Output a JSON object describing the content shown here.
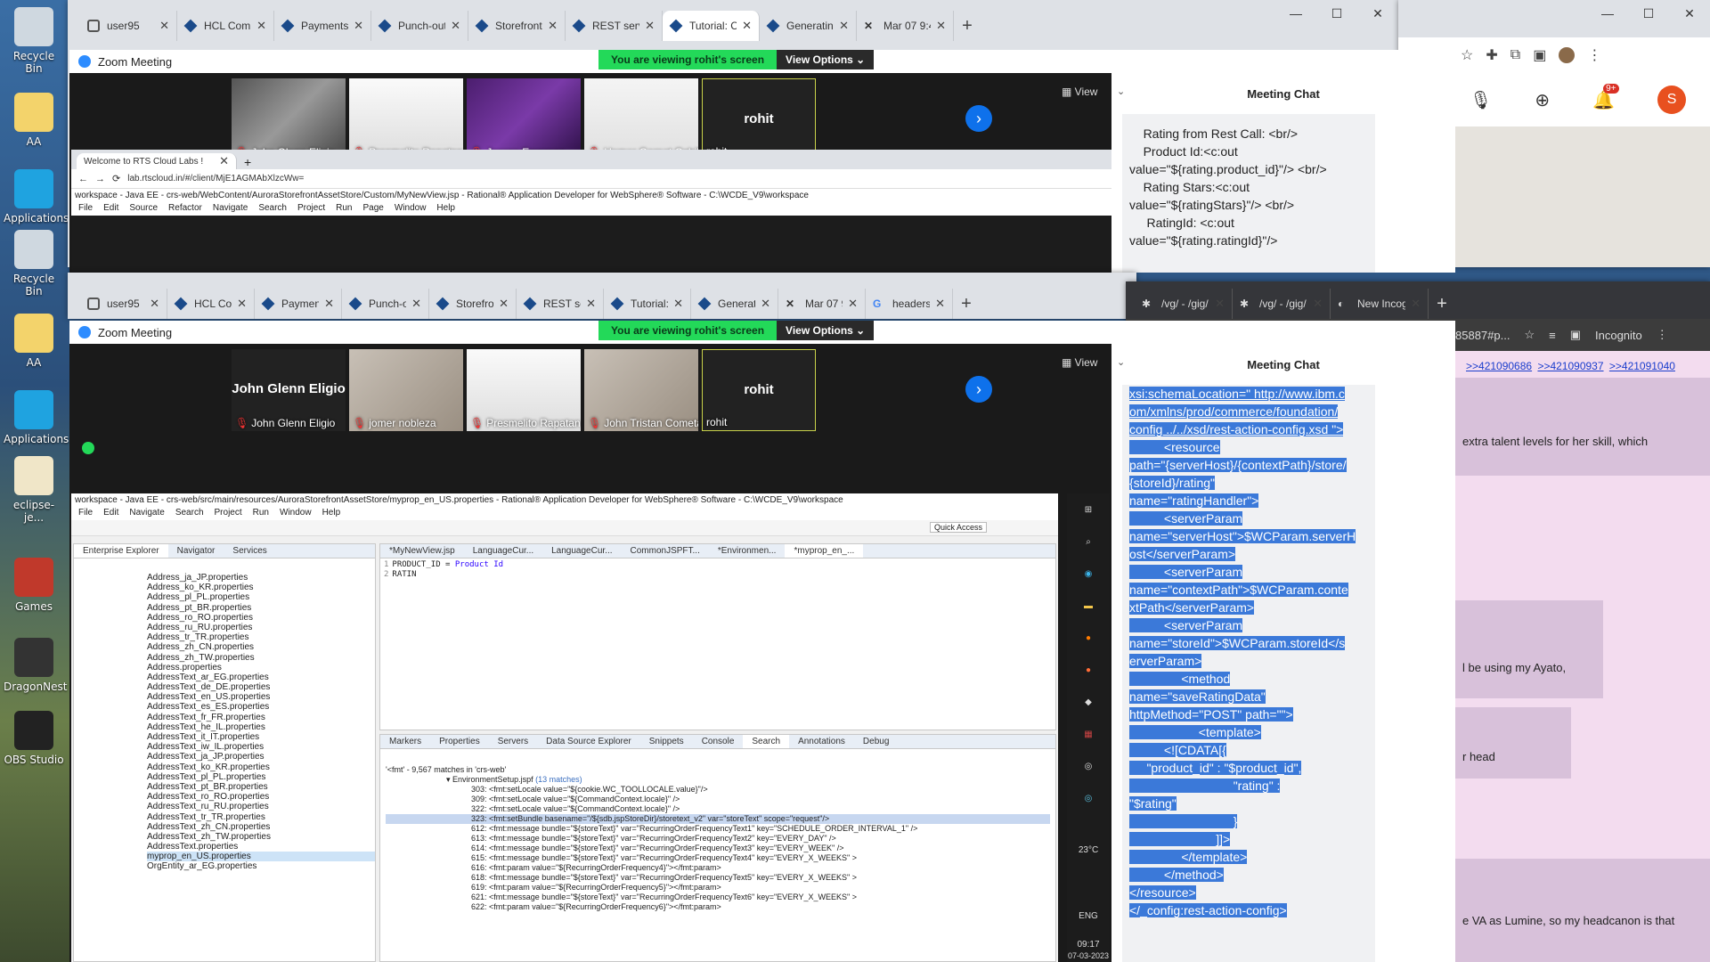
{
  "desktop": {
    "icons": [
      {
        "label": "Recycle Bin",
        "icon": "recycle-bin-icon"
      },
      {
        "label": "AA",
        "icon": "folder-icon"
      },
      {
        "label": "Applications",
        "icon": "edge-icon"
      },
      {
        "label": "Recycle Bin",
        "icon": "recycle-bin-icon"
      },
      {
        "label": "AA",
        "icon": "folder-icon"
      },
      {
        "label": "Applications",
        "icon": "edge-icon"
      },
      {
        "label": "eclipse-je...",
        "icon": "file-icon"
      },
      {
        "label": "Games",
        "icon": "games-icon"
      },
      {
        "label": "DragonNest",
        "icon": "dragonnest-icon"
      },
      {
        "label": "OBS Studio",
        "icon": "obs-icon"
      }
    ]
  },
  "top_browser": {
    "tabs": [
      "user95",
      "HCL Comme",
      "Payments sys",
      "Punch-out p",
      "Storefront RE",
      "REST service",
      "Tutorial: Crea",
      "Generating th",
      "Mar 07 9:49"
    ],
    "active_tab": 6
  },
  "bottom_browser": {
    "tabs": [
      "user95",
      "HCL Comm",
      "Payments",
      "Punch-out",
      "Storefront",
      "REST servi",
      "Tutorial: C",
      "Generating",
      "Mar 07 9:4",
      "headers c"
    ]
  },
  "incognito_browser": {
    "tabs": [
      "/vg/ - /gig/",
      "/vg/ - /gig/",
      "New Incogni"
    ],
    "profile_label": "Incognito",
    "url_fragment": "85887#p..."
  },
  "zoom_top": {
    "title": "Zoom Meeting",
    "banner": "You are viewing rohit's screen",
    "view_options": "View Options",
    "view_label": "View",
    "tiles": [
      {
        "name": "John Glenn Eligio",
        "muted": true,
        "style": "photo1"
      },
      {
        "name": "Presmelito Rapatan Villa...",
        "muted": true,
        "style": "photo2"
      },
      {
        "name": "Jeorge Emprese",
        "muted": true,
        "style": "photo3"
      },
      {
        "name": "Homer Garnet Cabilla",
        "muted": true,
        "style": "photo4"
      },
      {
        "name": "rohit",
        "big": "rohit",
        "muted": false,
        "style": "named"
      }
    ],
    "chat_title": "Meeting Chat",
    "chat_text": "    Rating from Rest Call: <br/>\n    Product Id:<c:out value=\"${rating.product_id}\"/> <br/>\n    Rating Stars:<c:out value=\"${ratingStars}\"/> <br/>\n     RatingId: <c:out value=\"${rating.ratingId}\"/>"
  },
  "zoom_bottom": {
    "title": "Zoom Meeting",
    "banner": "You are viewing rohit's screen",
    "view_options": "View Options",
    "view_label": "View",
    "tiles": [
      {
        "name": "John Glenn Eligio",
        "big": "John Glenn Eligio",
        "muted": true,
        "style": "named-dark"
      },
      {
        "name": "jomer nobleza",
        "muted": true,
        "style": "photo5"
      },
      {
        "name": "Presmelito Rapatan V...",
        "muted": true,
        "style": "photo2"
      },
      {
        "name": "John Tristan Cometa",
        "muted": true,
        "style": "photo5"
      },
      {
        "name": "rohit",
        "big": "rohit",
        "muted": false,
        "style": "named"
      }
    ],
    "chat_title": "Meeting Chat",
    "chat_lines": [
      "xsi:schemaLocation=\" http://www.ibm.c",
      "om/xmlns/prod/commerce/foundation/",
      "config ../../xsd/rest-action-config.xsd \">",
      "          <resource",
      "path=\"{serverHost}/{contextPath}/store/",
      "{storeId}/rating\"",
      "name=\"ratingHandler\">",
      "          <serverParam",
      "name=\"serverHost\">$WCParam.serverH",
      "ost</serverParam>",
      "          <serverParam",
      "name=\"contextPath\">$WCParam.conte",
      "xtPath</serverParam>",
      "          <serverParam",
      "name=\"storeId\">$WCParam.storeId</s",
      "erverParam>",
      "               <method",
      "name=\"saveRatingData\"",
      "httpMethod=\"POST\" path=\"\">",
      "                    <template>",
      "",
      "          <![CDATA[{",
      "",
      "     \"product_id\" : \"$product_id\",",
      "                              \"rating\" :",
      "\"$rating\"",
      "                              }",
      "                         ]]>",
      "               </template>",
      "          </method>",
      "</resource>",
      "</_config:rest-action-config>"
    ]
  },
  "inner_browser": {
    "tab": "Welcome to RTS Cloud Labs !",
    "url": "lab.rtscloud.in/#/client/MjE1AGMAbXlzcWw="
  },
  "eclipse_top": {
    "title": "workspace - Java EE - crs-web/WebContent/AuroraStorefrontAssetStore/Custom/MyNewView.jsp - Rational® Application Developer for WebSphere® Software - C:\\WCDE_V9\\workspace",
    "menu": [
      "File",
      "Edit",
      "Source",
      "Refactor",
      "Navigate",
      "Search",
      "Project",
      "Run",
      "Page",
      "Window",
      "Help"
    ]
  },
  "eclipse": {
    "title": "workspace - Java EE - crs-web/src/main/resources/AuroraStorefrontAssetStore/myprop_en_US.properties - Rational® Application Developer for WebSphere® Software - C:\\WCDE_V9\\workspace",
    "menu": [
      "File",
      "Edit",
      "Navigate",
      "Search",
      "Project",
      "Run",
      "Window",
      "Help"
    ],
    "quick_access": "Quick Access",
    "left_tabs": [
      "Enterprise Explorer",
      "Navigator",
      "Services"
    ],
    "files": [
      "Address_ja_JP.properties",
      "Address_ko_KR.properties",
      "Address_pl_PL.properties",
      "Address_pt_BR.properties",
      "Address_ro_RO.properties",
      "Address_ru_RU.properties",
      "Address_tr_TR.properties",
      "Address_zh_CN.properties",
      "Address_zh_TW.properties",
      "Address.properties",
      "AddressText_ar_EG.properties",
      "AddressText_de_DE.properties",
      "AddressText_en_US.properties",
      "AddressText_es_ES.properties",
      "AddressText_fr_FR.properties",
      "AddressText_he_IL.properties",
      "AddressText_it_IT.properties",
      "AddressText_iw_IL.properties",
      "AddressText_ja_JP.properties",
      "AddressText_ko_KR.properties",
      "AddressText_pl_PL.properties",
      "AddressText_pt_BR.properties",
      "AddressText_ro_RO.properties",
      "AddressText_ru_RU.properties",
      "AddressText_tr_TR.properties",
      "AddressText_zh_CN.properties",
      "AddressText_zh_TW.properties",
      "AddressText.properties",
      "myprop_en_US.properties",
      "OrgEntity_ar_EG.properties"
    ],
    "editor_tabs": [
      "*MyNewView.jsp",
      "LanguageCur...",
      "LanguageCur...",
      "CommonJSPFT...",
      "*Environmen...",
      "*myprop_en_..."
    ],
    "code_lines": [
      {
        "num": "1",
        "key": "PRODUCT_ID = ",
        "val": "Product Id"
      },
      {
        "num": "2",
        "key": "RATIN",
        "val": ""
      }
    ],
    "bottom_tabs": [
      "Markers",
      "Properties",
      "Servers",
      "Data Source Explorer",
      "Snippets",
      "Console",
      "Search",
      "Annotations",
      "Debug"
    ],
    "search_summary": "'<fmt' - 9,567 matches in 'crs-web'",
    "search_file": "EnvironmentSetup.jspf",
    "search_file_count": "(13 matches)",
    "results": [
      "303: <fmt:setLocale value=\"${cookie.WC_TOOLLOCALE.value}\"/>",
      "309: <fmt:setLocale value=\"${CommandContext.locale}\" />",
      "322: <fmt:setLocale value=\"${CommandContext.locale}\" />",
      "323: <fmt:setBundle basename=\"/${sdb.jspStoreDir}/storetext_v2\" var=\"storeText\" scope=\"request\"/>",
      "612: <fmt:message bundle=\"${storeText}\" var=\"RecurringOrderFrequencyText1\" key=\"SCHEDULE_ORDER_INTERVAL_1\" />",
      "613: <fmt:message bundle=\"${storeText}\" var=\"RecurringOrderFrequencyText2\" key=\"EVERY_DAY\" />",
      "614: <fmt:message bundle=\"${storeText}\" var=\"RecurringOrderFrequencyText3\" key=\"EVERY_WEEK\" />",
      "615: <fmt:message bundle=\"${storeText}\" var=\"RecurringOrderFrequencyText4\" key=\"EVERY_X_WEEKS\" >",
      "616: <fmt:param value=\"${RecurringOrderFrequency4}\"></fmt:param>",
      "618: <fmt:message bundle=\"${storeText}\" var=\"RecurringOrderFrequencyText5\" key=\"EVERY_X_WEEKS\" >",
      "619: <fmt:param value=\"${RecurringOrderFrequency5}\"></fmt:param>",
      "621: <fmt:message bundle=\"${storeText}\" var=\"RecurringOrderFrequencyText6\" key=\"EVERY_X_WEEKS\" >",
      "622: <fmt:param value=\"${RecurringOrderFrequency6}\"></fmt:param>"
    ]
  },
  "vtaskbar": {
    "temp": "23°C",
    "lang": "ENG",
    "time": "09:17",
    "date": "07-03-2023"
  },
  "right_chat": {
    "links": [
      ">>421090686",
      ">>421090937",
      ">>421091040"
    ],
    "lines": [
      "extra talent levels for her skill, which",
      "l be using my Ayato,",
      "r head",
      "e VA as Lumine, so my headcanon is that"
    ]
  },
  "chrome_right": {
    "notif_badge": "9+",
    "avatar_letter": "S"
  }
}
